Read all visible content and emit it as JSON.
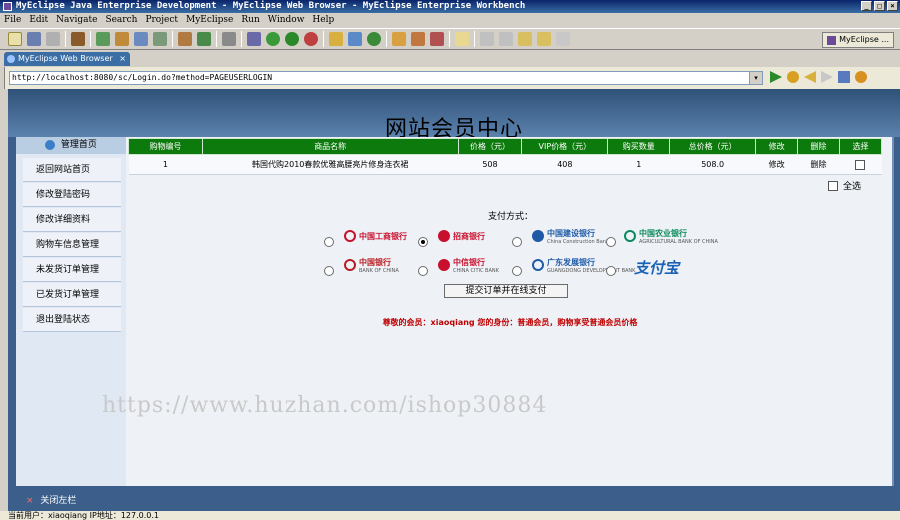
{
  "window": {
    "title": "MyEclipse Java Enterprise Development - MyEclipse Web Browser - MyEclipse Enterprise Workbench",
    "buttons": [
      "_",
      "□",
      "×"
    ]
  },
  "menu": [
    "File",
    "Edit",
    "Navigate",
    "Search",
    "Project",
    "MyEclipse",
    "Run",
    "Window",
    "Help"
  ],
  "perspective": "MyEclipse ...",
  "editor_tab": {
    "label": "MyEclipse Web Browser",
    "close": "×"
  },
  "browser": {
    "url": "http://localhost:8080/sc/Login.do?method=PAGEUSERLOGIN",
    "dropdown": "▾"
  },
  "site": {
    "title": "网站会员中心"
  },
  "sidebar": {
    "header": "管理首页",
    "items": [
      "返回网站首页",
      "修改登陆密码",
      "修改详细资料",
      "购物车信息管理",
      "未发货订单管理",
      "已发货订单管理",
      "退出登陆状态"
    ],
    "close_label": "关闭左栏",
    "close_symbol": "×"
  },
  "cart": {
    "headers": [
      "购物编号",
      "商品名称",
      "价格（元）",
      "VIP价格（元）",
      "购买数量",
      "总价格（元）",
      "修改",
      "删除",
      "选择"
    ],
    "rows": [
      {
        "id": "1",
        "name": "韩国代购2010春款优雅高腰亮片修身连衣裙",
        "price": "508",
        "vip_price": "408",
        "quantity": "1",
        "total": "508.0",
        "edit": "修改",
        "delete": "删除"
      }
    ],
    "select_all": "全选"
  },
  "payment": {
    "label": "支付方式：",
    "banks": [
      {
        "name": "中国工商银行",
        "sub": "",
        "color": "#c8102e",
        "selected": false
      },
      {
        "name": "招商银行",
        "sub": "",
        "color": "#c8102e",
        "selected": true
      },
      {
        "name": "中国建设银行",
        "sub": "China Construction Bank",
        "color": "#1f5aa6",
        "selected": false
      },
      {
        "name": "中国农业银行",
        "sub": "AGRICULTURAL BANK OF CHINA",
        "color": "#0a8a5a",
        "selected": false
      },
      {
        "name": "中国银行",
        "sub": "BANK OF CHINA",
        "color": "#b81c22",
        "selected": false
      },
      {
        "name": "中信银行",
        "sub": "CHINA CITIC BANK",
        "color": "#c8102e",
        "selected": false
      },
      {
        "name": "广东发展银行",
        "sub": "GUANGDONG DEVELOPMENT BANK",
        "color": "#1f5aa6",
        "selected": false
      }
    ],
    "alipay": "支付宝",
    "submit": "提交订单并在线支付"
  },
  "notice": "尊敬的会员：xiaoqiang 您的身份：普通会员，购物享受普通会员价格",
  "watermark": "https://www.huzhan.com/ishop30884",
  "status": "当前用户：xiaoqiang  IP地址：127.0.0.1"
}
